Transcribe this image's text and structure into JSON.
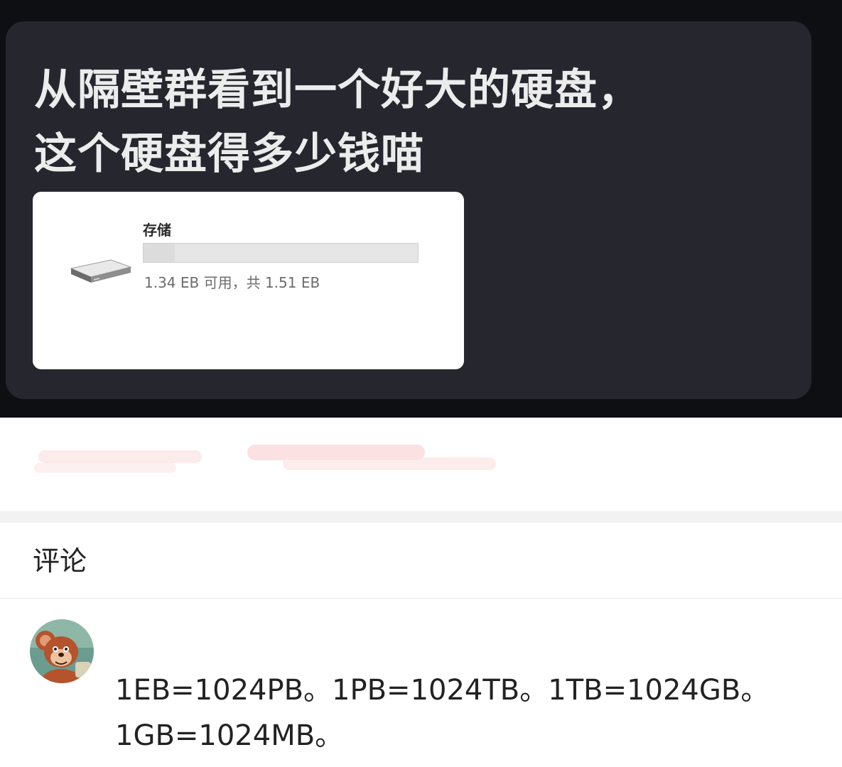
{
  "post": {
    "message_text": "从隔壁群看到一个好大的硬盘，\n这个硬盘得多少钱喵",
    "storage_card": {
      "title": "存储",
      "caption": "1.34 EB 可用，共 1.51 EB",
      "used_fraction": 0.113
    }
  },
  "comments": {
    "header": "评论",
    "items": [
      {
        "avatar_icon": "cartoon-mouse-avatar",
        "text": "1EB=1024PB。1PB=1024TB。1TB=1024GB。\n1GB=1024MB。"
      }
    ]
  },
  "colors": {
    "bubble_background": "#25262e",
    "page_dark_background": "#0e0f13",
    "message_text": "#ececec"
  }
}
